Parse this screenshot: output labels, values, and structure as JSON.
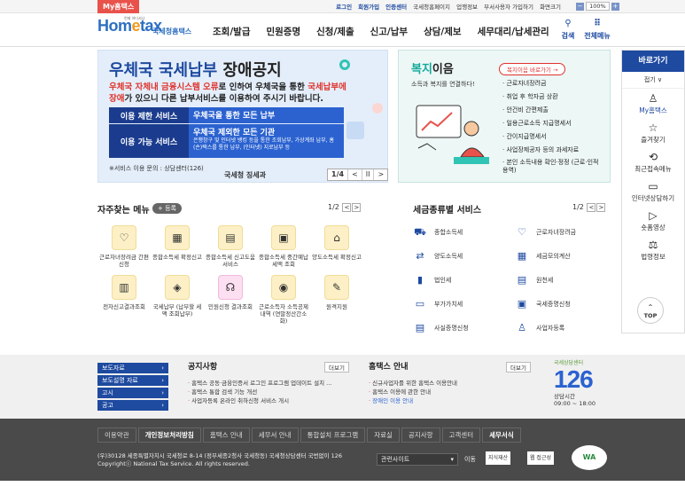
{
  "util": {
    "my_badge": "My홈택스",
    "links": [
      "로그인",
      "회원가입",
      "인증센터",
      "국세청홈페이지",
      "업행정보",
      "부서사용자 가입하기",
      "화면크기"
    ],
    "zoom_minus": "−",
    "zoom_value": "100%",
    "zoom_plus": "+"
  },
  "header": {
    "logo_main": "Hom",
    "logo_o": "e",
    "logo_rest": "tax",
    "logo_sub": "국세청홈택스",
    "logo_tiny": "언제 어디서나",
    "nav": [
      "조회/발급",
      "민원증명",
      "신청/제출",
      "신고/납부",
      "상담/제보",
      "세무대리/납세관리"
    ],
    "search": "검색",
    "all_menu": "전체메뉴"
  },
  "banner": {
    "title_blue": "우체국 국세납부",
    "title_dark": "장애공지",
    "desc1_a": "우체국 자체내 금융시스템 오류",
    "desc1_b": "로 인하여 우체국을 통한 ",
    "desc1_c": "국세납부에",
    "desc2_a": "장애",
    "desc2_b": "가 있으니 다른 납부서비스를 이용하여 주시기 바랍니다.",
    "row1_key": "이용 제한 서비스",
    "row1_val": "우체국을 통한 모든 납부",
    "row2_key": "이용 가능 서비스",
    "row2_val": "우체국 제외한 모든 기관",
    "row2_detail": "은행창구 및 인터넷 뱅킹 등을 통한 조회납부, 가상계좌 납부, 홈(손)택스를 통한 납부, (인터넷) 지로납부 등",
    "note": "※서비스 이용 문의 : 상담센터(126)",
    "sign": "국세청 징세과",
    "pager_count": "1/4",
    "pager_prev": "<",
    "pager_pause": "II",
    "pager_next": ">"
  },
  "welfare": {
    "title_a": "복지",
    "title_b": "이음",
    "subtitle": "소득과 복지를 연결하다!",
    "go_button": "복지이음 바로가기 →",
    "items": [
      "근로자녀장려금",
      "취업 후 학자금 상환",
      "안건비 간편제출",
      "일용근로소득 지급명세서",
      "간이지급명세서",
      "사업장제공자 등의 과세자료",
      "본인 소득내용 확인·정정 (근로·인적용역)"
    ]
  },
  "quick": {
    "title": "바로가기",
    "fold": "접기 ∨",
    "items": [
      {
        "icon": "person-icon",
        "glyph": "♙",
        "label": "My홈택스"
      },
      {
        "icon": "star-icon",
        "glyph": "☆",
        "label": "즐겨찾기"
      },
      {
        "icon": "recent-icon",
        "glyph": "⟲",
        "label": "최근접속메뉴"
      },
      {
        "icon": "monitor-icon",
        "glyph": "▭",
        "label": "인터넷상담하기"
      },
      {
        "icon": "play-icon",
        "glyph": "▷",
        "label": "숏폼영상"
      },
      {
        "icon": "gavel-icon",
        "glyph": "⚖",
        "label": "법령정보"
      }
    ],
    "top_arrow": "^",
    "top_label": "TOP"
  },
  "favorites": {
    "title": "자주찾는 메뉴",
    "register": "+ 등록",
    "pager": "1/2",
    "prev": "<",
    "next": ">",
    "items": [
      {
        "icon": "heart-icon",
        "glyph": "♡",
        "label": "근로자녀장려금 간편신청",
        "pink": false
      },
      {
        "icon": "calendar-icon",
        "glyph": "▦",
        "label": "종합소득세 확정신고",
        "pink": false
      },
      {
        "icon": "document-icon",
        "glyph": "▤",
        "label": "종합소득세 신고도움 서비스",
        "pink": false
      },
      {
        "icon": "document-search-icon",
        "glyph": "▣",
        "label": "종합소득세 중간예납세액 조회",
        "pink": false
      },
      {
        "icon": "house-icon",
        "glyph": "⌂",
        "label": "양도소득세 확정신고",
        "pink": false
      },
      {
        "icon": "report-icon",
        "glyph": "▥",
        "label": "전자신고결과조회",
        "pink": false
      },
      {
        "icon": "wallet-icon",
        "glyph": "◈",
        "label": "국세납부 (납부할 세액 조회납부)",
        "pink": false
      },
      {
        "icon": "headset-icon",
        "glyph": "☊",
        "label": "민원신청 결과조회",
        "pink": true
      },
      {
        "icon": "money-icon",
        "glyph": "◉",
        "label": "근로소득자 소득공제 내역 (연말정산간소화)",
        "pink": false
      },
      {
        "icon": "person-pen-icon",
        "glyph": "✎",
        "label": "원격지원",
        "pink": false
      }
    ]
  },
  "taxtypes": {
    "title": "세금종류별 서비스",
    "pager": "1/2",
    "prev": "<",
    "next": ">",
    "items": [
      {
        "icon": "car-icon",
        "glyph": "⛟",
        "label": "종합소득세"
      },
      {
        "icon": "heart-hand-icon",
        "glyph": "♡",
        "label": "근로자녀장려금"
      },
      {
        "icon": "transfer-icon",
        "glyph": "⇄",
        "label": "양도소득세"
      },
      {
        "icon": "calculator-icon",
        "glyph": "▦",
        "label": "세금모의계산"
      },
      {
        "icon": "building-icon",
        "glyph": "▮",
        "label": "법인세"
      },
      {
        "icon": "receipt-icon",
        "glyph": "▤",
        "label": "원천세"
      },
      {
        "icon": "vat-icon",
        "glyph": "▭",
        "label": "부가가치세"
      },
      {
        "icon": "certificate-icon",
        "glyph": "▣",
        "label": "국세증명신청"
      },
      {
        "icon": "document-icon",
        "glyph": "▤",
        "label": "사실증명신청"
      },
      {
        "icon": "person-icon",
        "glyph": "♙",
        "label": "사업자등록"
      }
    ]
  },
  "notice": {
    "side_buttons": [
      "보도자료",
      "보도설명 자료",
      "고시",
      "공고"
    ],
    "side_arrow": "›",
    "notice_title": "공지사항",
    "notice_more": "더보기",
    "notice_items": [
      "홈택스 공동·금융인증서 로그인 프로그램 업데이트 설치 ...",
      "홈택스 통합 검색 기능 개선",
      "사업자등록 온라인 취하신청 서비스 개시"
    ],
    "guide_title": "홈택스 안내",
    "guide_more": "더보기",
    "guide_items": [
      "신규사업자를 위한 홈택스 이용안내",
      "홈택스 이용에 관한 안내",
      "장애인 이용 안내"
    ],
    "call_top": "국세상담센터",
    "call_num": "126",
    "call_label": "상담시간",
    "call_hours": "09:00 ~ 18:00"
  },
  "footer": {
    "nav": [
      "이용약관",
      "개인정보처리방침",
      "홈택스 안내",
      "세무서 안내",
      "통합설치 프로그램",
      "자료실",
      "공지사항",
      "고객센터",
      "세무서식"
    ],
    "addr1": "(우)30128 세종특별자치시 국세청로 8-14 (정부세종2청사 국세청동) 국세청상담센터 국번없이 126",
    "addr2": "Copyrightⓒ National Tax Service. All rights reserved.",
    "related_select": "관련사이트",
    "move": "이동",
    "badge1": "지식재산",
    "badge2": "웹 접근성",
    "wa": "WA"
  }
}
